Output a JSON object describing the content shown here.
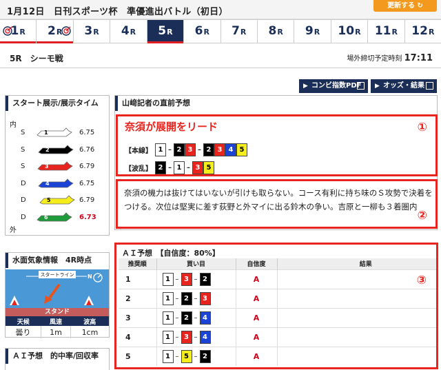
{
  "header": {
    "title": "1月12日　日刊スポーツ杯　準優進出バトル（初日）",
    "update_label": "更新する ↻"
  },
  "tabs": [
    {
      "num": "1",
      "suffix": "R",
      "marked": true
    },
    {
      "num": "2",
      "suffix": "R",
      "marked": true
    },
    {
      "num": "3",
      "suffix": "R"
    },
    {
      "num": "4",
      "suffix": "R"
    },
    {
      "num": "5",
      "suffix": "R",
      "active": true
    },
    {
      "num": "6",
      "suffix": "R"
    },
    {
      "num": "7",
      "suffix": "R"
    },
    {
      "num": "8",
      "suffix": "R"
    },
    {
      "num": "9",
      "suffix": "R"
    },
    {
      "num": "10",
      "suffix": "R"
    },
    {
      "num": "11",
      "suffix": "R"
    },
    {
      "num": "12",
      "suffix": "R"
    }
  ],
  "race": {
    "name": "5R　シーモ戦",
    "deadline_label": "場外締切予定時刻",
    "deadline_time": "17:11"
  },
  "buttons": {
    "combi": "コンビ指数PDF",
    "odds": "オッズ・結果"
  },
  "exhibition": {
    "title": "スタート展示/展示タイム",
    "inner": "内",
    "outer": "外",
    "rows": [
      {
        "label": "S",
        "boat": "1",
        "time": "6.75",
        "best": false
      },
      {
        "label": "S",
        "boat": "2",
        "time": "6.76",
        "best": false
      },
      {
        "label": "S",
        "boat": "3",
        "time": "6.79",
        "best": false
      },
      {
        "label": "D",
        "boat": "4",
        "time": "6.75",
        "best": false
      },
      {
        "label": "D",
        "boat": "5",
        "time": "6.79",
        "best": false
      },
      {
        "label": "D",
        "boat": "6",
        "time": "6.73",
        "best": true
      }
    ]
  },
  "weather": {
    "title": "水面気象情報　4R時点",
    "start_line": "スタートライン",
    "stand": "スタンド",
    "headers": [
      "天候",
      "風速",
      "波高"
    ],
    "values": [
      "曇り",
      "1m",
      "1cm"
    ],
    "north": "N"
  },
  "ai_rate": {
    "title": "ＡＩ予想　的中率/回収率"
  },
  "reporter": {
    "title": "山﨑記者の直前予想",
    "headline": "奈須が展開をリード",
    "badge1": "①",
    "badge2": "②",
    "badge3": "③",
    "main_label": "【本線】",
    "main_combo": [
      "1",
      "2",
      "3",
      "2",
      "3",
      "4",
      "5"
    ],
    "wave_label": "【波乱】",
    "wave_combo": [
      "2",
      "1",
      "3",
      "5"
    ],
    "comment": "奈須の機力は抜けてはいないが引けも取らない。コース有利に持ち味のＳ攻勢で決着をつける。次位は堅実に差す荻野と外マイに出る鈴木の争い。吉原と一柳も３着圏内"
  },
  "ai": {
    "title": "ＡＩ予想　【自信度：80%】",
    "headers": [
      "推奨順",
      "買い目",
      "自信度",
      "結果"
    ],
    "rows": [
      {
        "rank": "1",
        "combo": [
          "1",
          "3",
          "2"
        ],
        "conf": "A",
        "result": ""
      },
      {
        "rank": "2",
        "combo": [
          "1",
          "2",
          "3"
        ],
        "conf": "A",
        "result": ""
      },
      {
        "rank": "3",
        "combo": [
          "1",
          "2",
          "4"
        ],
        "conf": "A",
        "result": ""
      },
      {
        "rank": "4",
        "combo": [
          "1",
          "3",
          "4"
        ],
        "conf": "A",
        "result": ""
      },
      {
        "rank": "5",
        "combo": [
          "1",
          "5",
          "2"
        ],
        "conf": "A",
        "result": ""
      }
    ]
  },
  "colors": {
    "navy": "#1a2e57",
    "red_highlight": "#e8241f",
    "orange": "#f39a1e",
    "boat_1": "#ffffff",
    "boat_2": "#000000",
    "boat_3": "#e8241f",
    "boat_4": "#1b44d6",
    "boat_5": "#f6ee1c",
    "boat_6": "#1f9b3a"
  }
}
